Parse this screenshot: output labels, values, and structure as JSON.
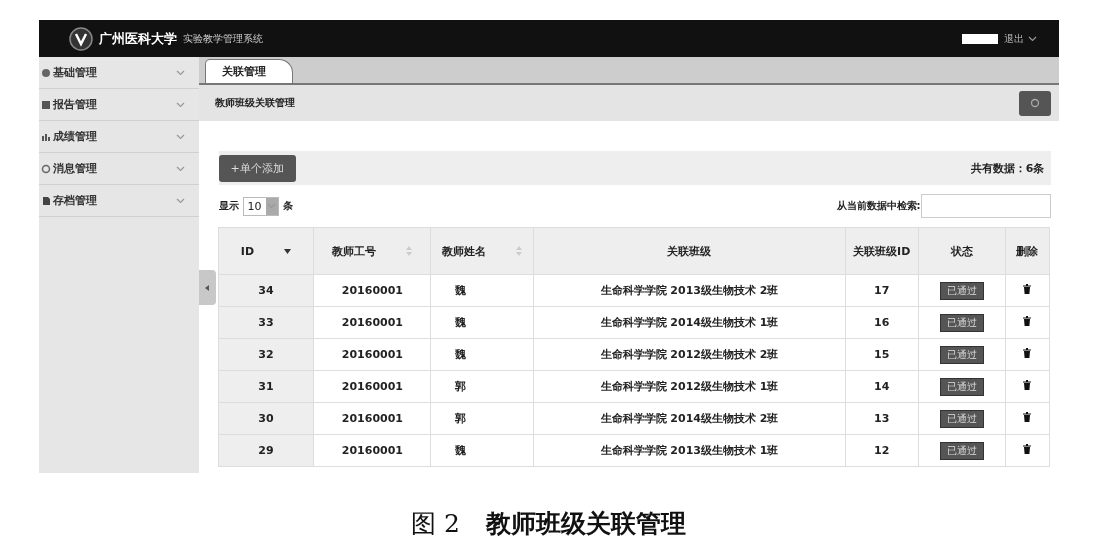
{
  "header": {
    "school": "广州医科大学",
    "system": "实验教学管理系统",
    "user_menu": "退出"
  },
  "sidebar": {
    "items": [
      {
        "label": "基础管理",
        "expanded": false
      },
      {
        "label": "报告管理",
        "expanded": false
      },
      {
        "label": "成绩管理",
        "expanded": false
      },
      {
        "label": "消息管理",
        "expanded": false
      },
      {
        "label": "存档管理",
        "expanded": false
      }
    ]
  },
  "tabs": [
    {
      "label": "关联管理",
      "selected": true
    }
  ],
  "panel": {
    "title": "教师班级关联管理",
    "add_button": "+单个添加",
    "total": "共有数据：6条",
    "show_label": "显示",
    "page_size": "10",
    "unit": "条",
    "search_label": "从当前数据中检索:"
  },
  "table": {
    "columns": [
      {
        "label": "ID",
        "sortable": true,
        "sorted": true
      },
      {
        "label": "教师工号",
        "sortable": true,
        "sorted": false
      },
      {
        "label": "教师姓名",
        "sortable": true,
        "sorted": false
      },
      {
        "label": "关联班级",
        "sortable": false
      },
      {
        "label": "关联班级ID",
        "sortable": false
      },
      {
        "label": "状态",
        "sortable": false
      },
      {
        "label": "删除",
        "sortable": false
      }
    ],
    "rows": [
      {
        "id": "34",
        "teacher_no": "20160001",
        "name": "魏",
        "class": "生命科学学院 2013级生物技术 2班",
        "class_id": "17",
        "status": "已通过"
      },
      {
        "id": "33",
        "teacher_no": "20160001",
        "name": "魏",
        "class": "生命科学学院 2014级生物技术 1班",
        "class_id": "16",
        "status": "已通过"
      },
      {
        "id": "32",
        "teacher_no": "20160001",
        "name": "魏",
        "class": "生命科学学院 2012级生物技术 2班",
        "class_id": "15",
        "status": "已通过"
      },
      {
        "id": "31",
        "teacher_no": "20160001",
        "name": "郭",
        "class": "生命科学学院 2012级生物技术 1班",
        "class_id": "14",
        "status": "已通过"
      },
      {
        "id": "30",
        "teacher_no": "20160001",
        "name": "郭",
        "class": "生命科学学院 2014级生物技术 2班",
        "class_id": "13",
        "status": "已通过"
      },
      {
        "id": "29",
        "teacher_no": "20160001",
        "name": "魏",
        "class": "生命科学学院 2013级生物技术 1班",
        "class_id": "12",
        "status": "已通过"
      }
    ]
  },
  "caption": {
    "label": "图 2",
    "text": "教师班级关联管理"
  }
}
